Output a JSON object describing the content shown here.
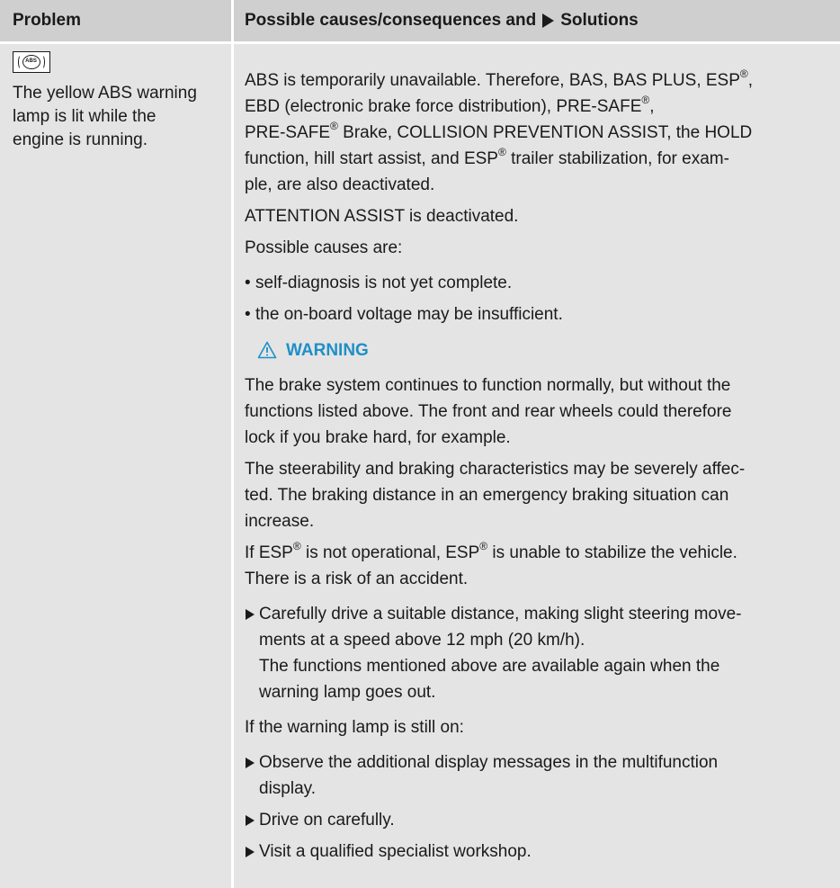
{
  "header": {
    "problem": "Problem",
    "causes_prefix": "Possible causes/consequences and",
    "causes_suffix": "Solutions"
  },
  "problem": {
    "icon": "abs-warning-lamp-icon",
    "icon_text": "ABS",
    "line1": "The yellow ABS warning",
    "line2": "lamp is lit while the",
    "line3": "engine is running."
  },
  "content": {
    "p1": {
      "l1_a": "ABS is temporarily unavailable. Therefore, BAS, BAS PLUS, ESP",
      "l1_b": ",",
      "l2_a": "EBD (electronic brake force distribution), PRE-SAFE",
      "l2_b": ",",
      "l3_a": "PRE-SAFE",
      "l3_b": " Brake, COLLISION PREVENTION ASSIST, the HOLD",
      "l4_a": "function, hill start assist, and ESP",
      "l4_b": " trailer stabilization, for exam-",
      "l5": "ple, are also deactivated."
    },
    "reg": "®",
    "p2": "ATTENTION ASSIST is deactivated.",
    "p3": "Possible causes are:",
    "bullets": [
      "self-diagnosis is not yet complete.",
      "the on-board voltage may be insufficient."
    ],
    "warning_title": "WARNING",
    "w1_l1": "The brake system continues to function normally, but without the",
    "w1_l2": "functions listed above. The front and rear wheels could therefore",
    "w1_l3": "lock if you brake hard, for example.",
    "w2_l1": "The steerability and braking characteristics may be severely affec-",
    "w2_l2": "ted. The braking distance in an emergency braking situation can",
    "w2_l3": "increase.",
    "w3_a": "If ESP",
    "w3_b": " is not operational, ESP",
    "w3_c": " is unable to stabilize the vehicle.",
    "w4": "There is a risk of an accident.",
    "step1_l1": "Carefully drive a suitable distance, making slight steering move-",
    "step1_l2": "ments at a speed above 12 mph (20 km/h).",
    "step1_l3": "The functions mentioned above are available again when the",
    "step1_l4": "warning lamp goes out.",
    "p4": "If the warning lamp is still on:",
    "steps": [
      {
        "l1": "Observe the additional display messages in the multifunction",
        "l2": "display."
      },
      {
        "l1": "Drive on carefully.",
        "l2": ""
      },
      {
        "l1": "Visit a qualified specialist workshop.",
        "l2": ""
      }
    ]
  },
  "colors": {
    "header_bg": "#cfcfcf",
    "row_bg": "#e4e4e4",
    "warning": "#1f8fc7"
  }
}
